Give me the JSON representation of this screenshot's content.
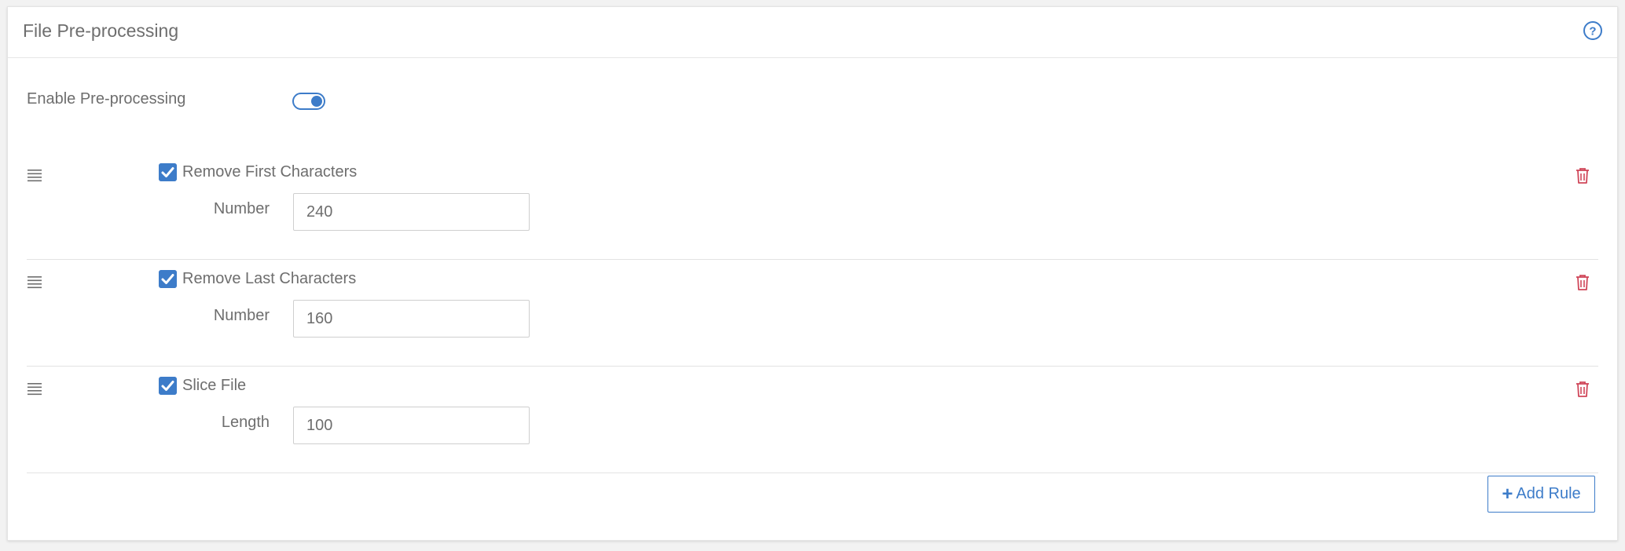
{
  "panel": {
    "title": "File Pre-processing",
    "help_icon": "question-circle-icon"
  },
  "enable": {
    "label": "Enable Pre-processing",
    "enabled": true
  },
  "rules": [
    {
      "checked": true,
      "label": "Remove First Characters",
      "field_label": "Number",
      "value": "240"
    },
    {
      "checked": true,
      "label": "Remove Last Characters",
      "field_label": "Number",
      "value": "160"
    },
    {
      "checked": true,
      "label": "Slice File",
      "field_label": "Length",
      "value": "100"
    }
  ],
  "add_rule": {
    "label": "Add Rule",
    "icon": "plus-icon"
  },
  "colors": {
    "accent": "#3d7cc9",
    "delete": "#d0475a",
    "text": "#6e6e6e",
    "border": "#e3e3e3"
  }
}
